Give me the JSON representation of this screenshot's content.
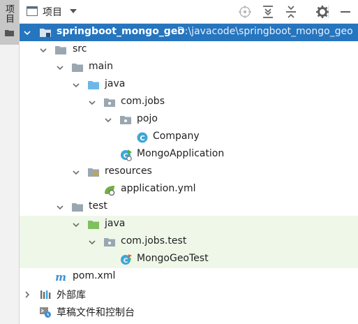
{
  "side_strip": {
    "tab_label": "项目"
  },
  "toolbar": {
    "title": "项目",
    "buttons": [
      "locate-icon",
      "expand-all-icon",
      "collapse-all-icon",
      "gear-icon",
      "minimize-icon"
    ]
  },
  "tree": {
    "root": {
      "name": "springboot_mongo_geo",
      "path": "D:\\javacode\\springboot_mongo_geo"
    },
    "src": "src",
    "main": "main",
    "main_java": "java",
    "com_jobs": "com.jobs",
    "pojo": "pojo",
    "company": "Company",
    "mongo_application": "MongoApplication",
    "resources": "resources",
    "application_yml": "application.yml",
    "test": "test",
    "test_java": "java",
    "com_jobs_test": "com.jobs.test",
    "mongo_geo_test": "MongoGeoTest",
    "pom": "pom.xml",
    "external_libs": "外部库",
    "scratches": "草稿文件和控制台"
  },
  "colors": {
    "selection": "#2675bf",
    "test_highlight": "#eff7e9",
    "folder_gray": "#9aa7b0",
    "source_folder_blue": "#6cb7e8",
    "test_folder_green": "#7fbf5f",
    "class_icon": "#3fa7d6"
  }
}
